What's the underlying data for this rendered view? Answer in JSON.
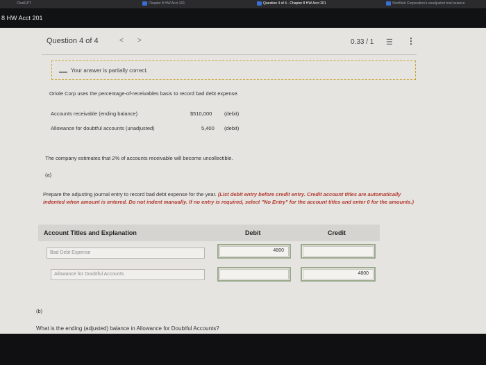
{
  "browser": {
    "tabs": [
      "ChatGPT",
      "Chapter 8 HW Acct 201",
      "Question 4 of 4 - Chapter 8 HW Acct 201",
      "Sheffield Corporation's unadjusted trial balance"
    ]
  },
  "course": {
    "title": "8 HW Acct 201"
  },
  "question": {
    "header": "Question 4 of 4",
    "prev": "<",
    "next": ">",
    "score": "0.33 / 1",
    "list_icon": "☰",
    "more_icon": "⋮"
  },
  "feedback": {
    "icon": "—",
    "text": "Your answer is partially correct."
  },
  "problem": {
    "intro": "Oriole Corp uses the percentage-of-receivables basis to record bad debt expense.",
    "rows": [
      {
        "label": "Accounts receivable (ending balance)",
        "amount": "$510,000",
        "type": "(debit)"
      },
      {
        "label": "Allowance for doubtful accounts (unadjusted)",
        "amount": "5,400",
        "type": "(debit)"
      }
    ],
    "estimate": "The company estimates that 2% of accounts receivable will become uncollectible."
  },
  "part_a": {
    "label": "(a)",
    "instruction": "Prepare the adjusting journal entry to record bad debt expense for the year.",
    "instruction_red": "(List debit entry before credit entry. Credit account titles are automatically indented when amount is entered. Do not indent manually. If no entry is required, select \"No Entry\" for the account titles and enter 0 for the amounts.)"
  },
  "journal": {
    "col_account": "Account Titles and Explanation",
    "col_debit": "Debit",
    "col_credit": "Credit",
    "rows": [
      {
        "account": "Bad Debt Expense",
        "debit": "4800",
        "credit": ""
      },
      {
        "account": "Allowance for Doubtful Accounts",
        "debit": "",
        "credit": "4800"
      }
    ]
  },
  "part_b": {
    "label": "(b)",
    "question": "What is the ending (adjusted) balance in Allowance for Doubtful Accounts?"
  }
}
